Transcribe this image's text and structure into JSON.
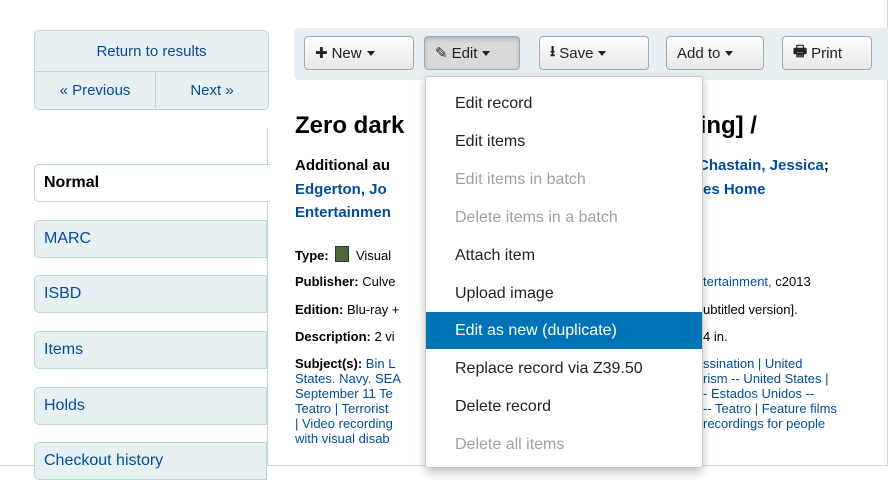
{
  "nav": {
    "return_label": "Return to results",
    "previous_label": "« Previous",
    "next_label": "Next »"
  },
  "views": [
    "Normal",
    "MARC",
    "ISBD",
    "Items",
    "Holds",
    "Checkout history"
  ],
  "toolbar": {
    "new_label": "New",
    "edit_label": "Edit",
    "save_label": "Save",
    "addto_label": "Add to",
    "print_label": "Print"
  },
  "record": {
    "title_left": "Zero dark",
    "title_right": "ding] /",
    "additional_label": "Additional au",
    "author_tail": "Chastain, Jessica",
    "author_sep": ";",
    "line2a": "Edgerton, Jo",
    "line2b": "es Home",
    "line3": "Entertainmen",
    "type_label": "Type:",
    "type_value": "Visual",
    "publisher_label": "Publisher:",
    "publisher_value": "Culve",
    "publisher_tail_link": "tertainment,",
    "publisher_year": "c2013",
    "edition_label": "Edition:",
    "edition_value": "Blu-ray +",
    "edition_tail": "ubtitled version].",
    "description_label": "Description:",
    "description_value": "2 vi",
    "description_tail": "4 in.",
    "subjects_label": "Subject(s):",
    "subjects_lines": [
      [
        "Bin L",
        "ssination | United"
      ],
      [
        "States. Navy. SEA",
        "rism -- United States |"
      ],
      [
        "September 11 Te",
        "- Estados Unidos --"
      ],
      [
        "Teatro | Terrorist",
        "-- Teatro | Feature films"
      ],
      [
        "| Video recording",
        "recordings for people"
      ],
      [
        "with visual disab",
        ""
      ]
    ]
  },
  "edit_menu": {
    "items": [
      {
        "label": "Edit record",
        "state": "normal"
      },
      {
        "label": "Edit items",
        "state": "normal"
      },
      {
        "label": "Edit items in batch",
        "state": "disabled"
      },
      {
        "label": "Delete items in a batch",
        "state": "disabled"
      },
      {
        "label": "Attach item",
        "state": "normal"
      },
      {
        "label": "Upload image",
        "state": "normal"
      },
      {
        "label": "Edit as new (duplicate)",
        "state": "active"
      },
      {
        "label": "Replace record via Z39.50",
        "state": "normal"
      },
      {
        "label": "Delete record",
        "state": "normal"
      },
      {
        "label": "Delete all items",
        "state": "disabled"
      }
    ]
  },
  "colors": {
    "accent": "#0073b7",
    "link": "#004d99",
    "panel": "#e6f0f2"
  }
}
